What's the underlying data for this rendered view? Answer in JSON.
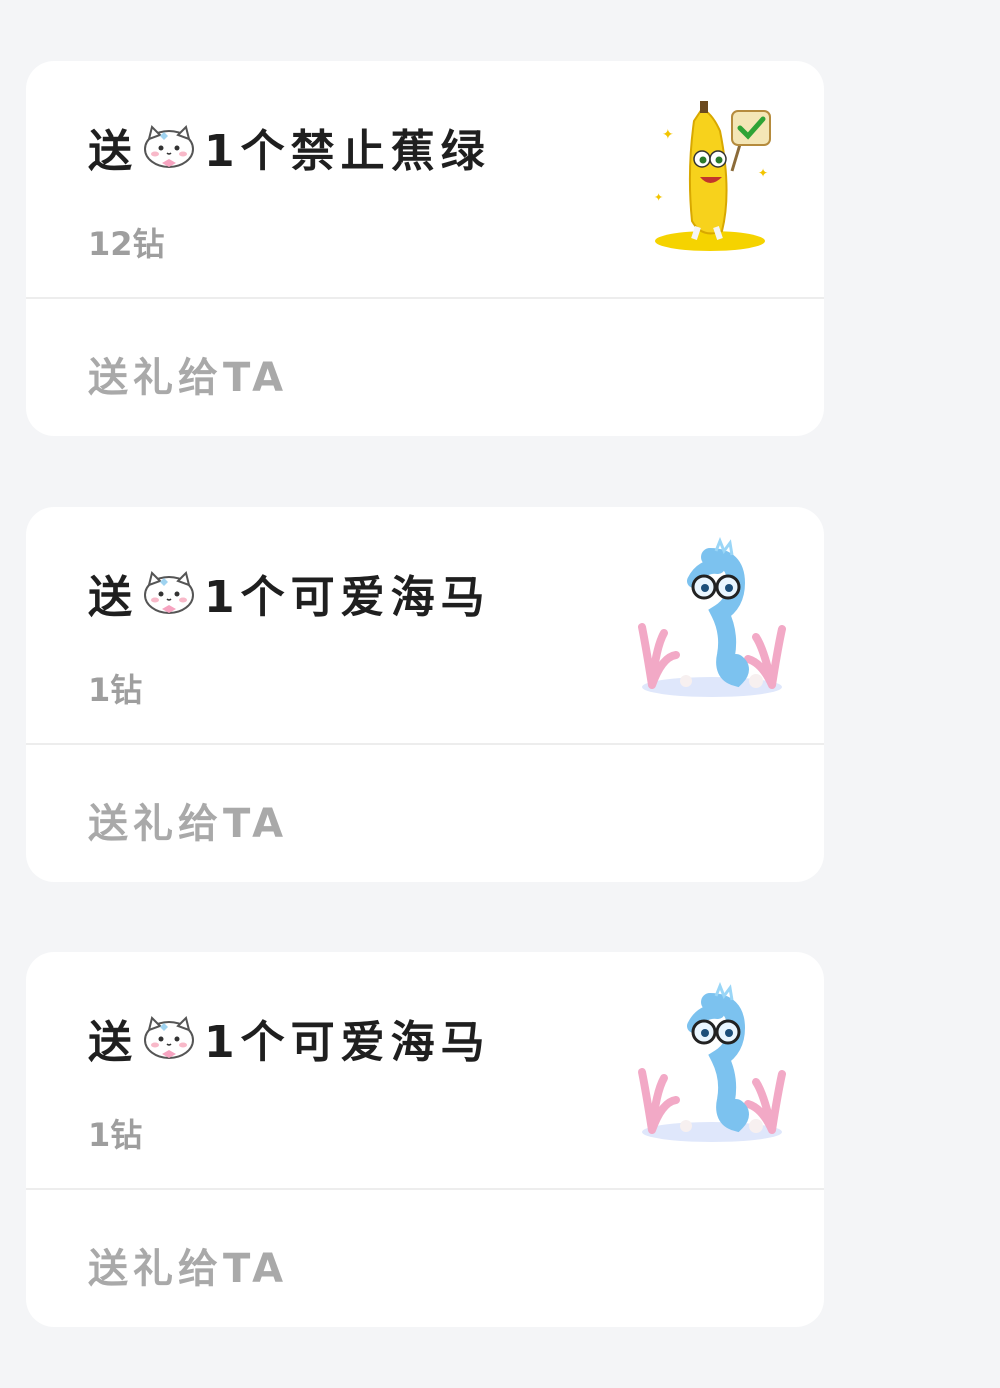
{
  "cards": [
    {
      "prefix": "送",
      "item": "1个禁止蕉绿",
      "price": "12钻",
      "action": "送礼给TA",
      "gift_icon": "banana-sign-icon"
    },
    {
      "prefix": "送",
      "item": "1个可爱海马",
      "price": "1钻",
      "action": "送礼给TA",
      "gift_icon": "seahorse-icon"
    },
    {
      "prefix": "送",
      "item": "1个可爱海马",
      "price": "1钻",
      "action": "送礼给TA",
      "gift_icon": "seahorse-icon"
    }
  ],
  "colors": {
    "background": "#f4f5f7",
    "card": "#ffffff",
    "title": "#1f1f1f",
    "muted": "#9e9e9e"
  }
}
